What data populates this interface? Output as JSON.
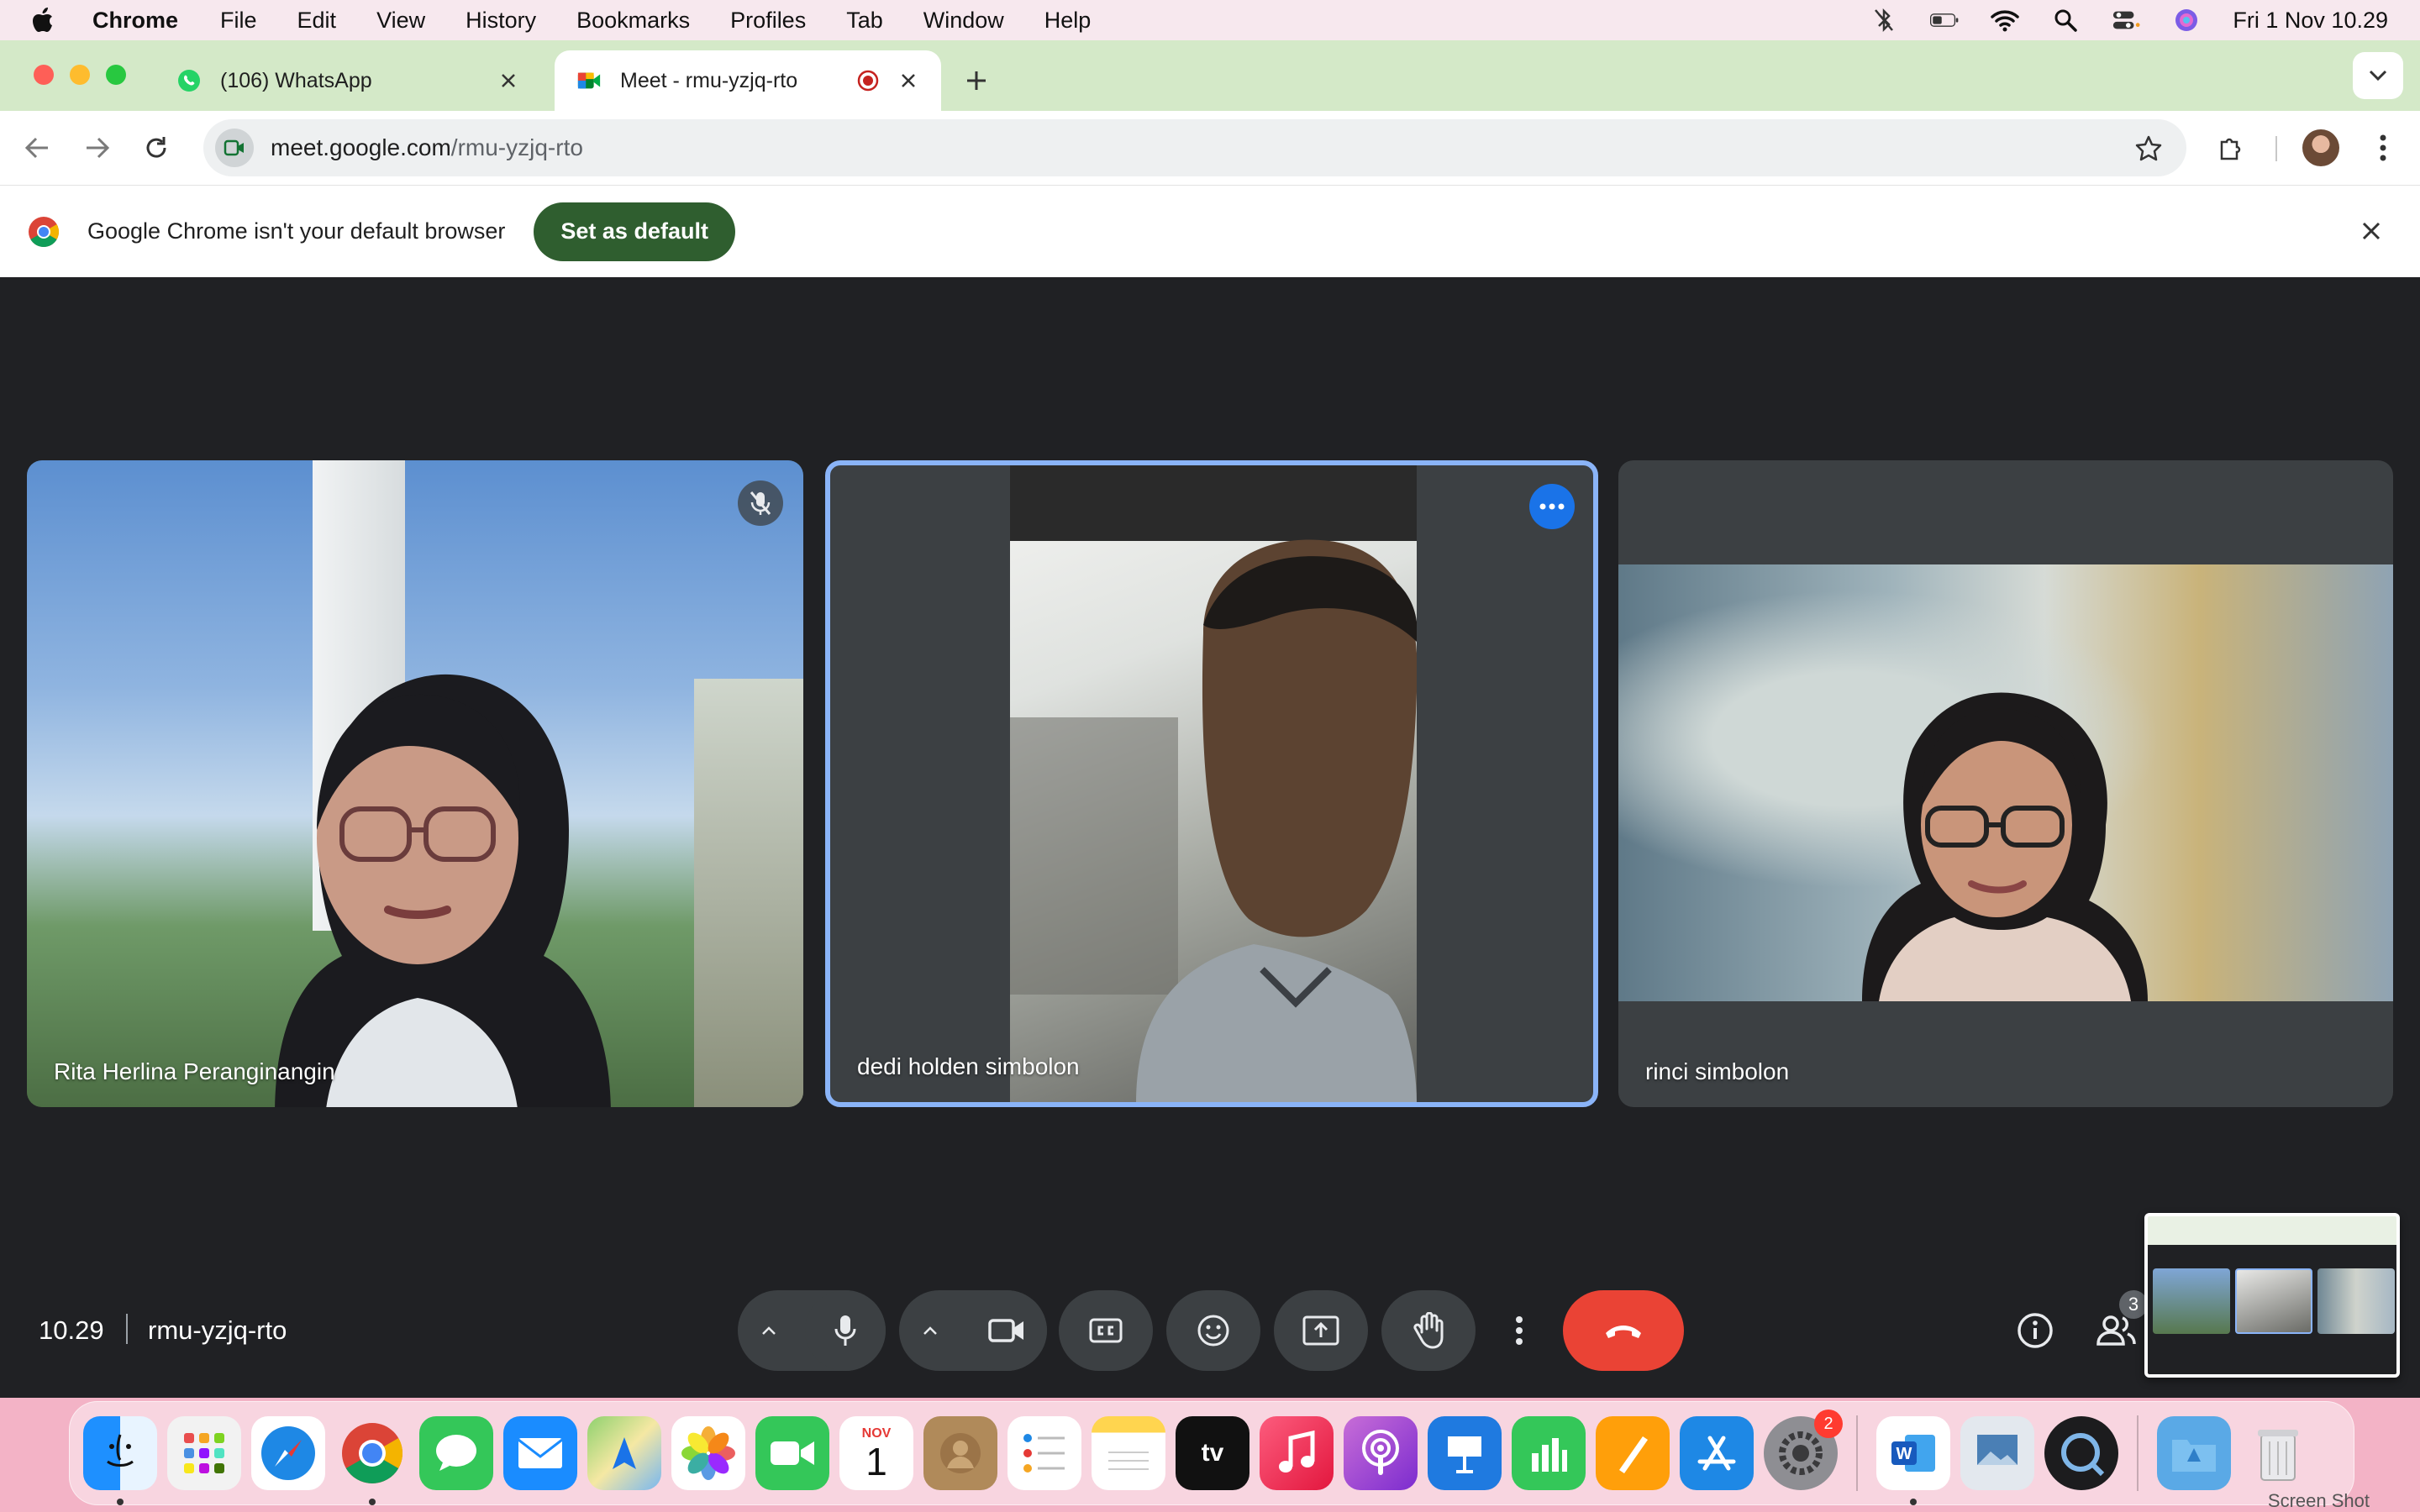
{
  "menubar": {
    "app_name": "Chrome",
    "items": [
      "File",
      "Edit",
      "View",
      "History",
      "Bookmarks",
      "Profiles",
      "Tab",
      "Window",
      "Help"
    ],
    "clock": "Fri 1 Nov  10.29"
  },
  "tabs": [
    {
      "title": "(106) WhatsApp",
      "favicon": "whatsapp-icon",
      "active": false
    },
    {
      "title": "Meet - rmu-yzjq-rto",
      "favicon": "google-meet-icon",
      "active": true,
      "recording": true
    }
  ],
  "address_bar": {
    "domain": "meet.google.com",
    "path": "/rmu-yzjq-rto"
  },
  "infobar": {
    "message": "Google Chrome isn't your default browser",
    "button_label": "Set as default"
  },
  "meet": {
    "time": "10.29",
    "meeting_code": "rmu-yzjq-rto",
    "participants": [
      {
        "name": "Rita Herlina Peranginangin",
        "muted": true
      },
      {
        "name": "dedi holden simbolon",
        "active_speaker": true
      },
      {
        "name": "rinci simbolon"
      }
    ],
    "participant_count": "3"
  },
  "dock": {
    "apps": [
      "Finder",
      "Launchpad",
      "Safari",
      "Chrome",
      "Messages",
      "Mail",
      "Maps",
      "Photos",
      "FaceTime",
      "Calendar",
      "Contacts",
      "Reminders",
      "Notes",
      "TV",
      "Music",
      "Podcasts",
      "Keynote",
      "Numbers",
      "Pages",
      "App Store",
      "System Settings",
      "Word",
      "Preview",
      "QuickTime",
      "Downloads",
      "Trash"
    ],
    "calendar_month": "NOV",
    "calendar_day": "1",
    "settings_badge": "2",
    "corner_label": "Screen Shot"
  },
  "colors": {
    "meet_bg": "#202124",
    "tile_bg": "#3c4043",
    "end_call": "#ea4335",
    "active_border": "#8ab4f8",
    "set_default_btn": "#2f5e2f"
  }
}
